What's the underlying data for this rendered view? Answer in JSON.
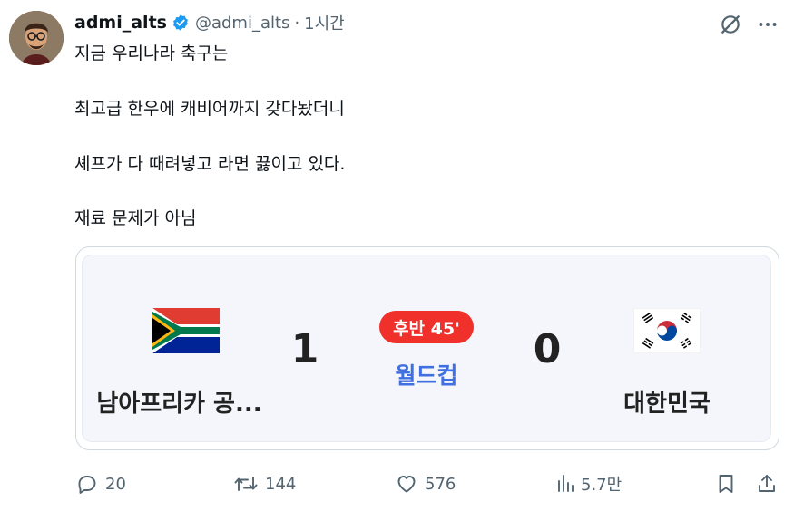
{
  "tweet": {
    "display_name": "admi_alts",
    "handle": "@admi_alts",
    "separator": "·",
    "time": "1시간",
    "lines": [
      "지금 우리나라 축구는",
      "최고급 한우에 캐비어까지 갖다놨더니",
      "셰프가 다 때려넣고 라면 끓이고 있다.",
      "재료 문제가 아님"
    ]
  },
  "scorecard": {
    "home_team": "남아프리카 공...",
    "home_score": "1",
    "away_team": "대한민국",
    "away_score": "0",
    "status": "후반 45'",
    "competition": "월드컵",
    "status_color": "#f0302b",
    "competition_color": "#3f6fe0"
  },
  "actions": {
    "replies": "20",
    "reposts": "144",
    "likes": "576",
    "views": "5.7만"
  },
  "icons": {
    "verified": "verified-badge-icon",
    "grok": "grok-icon",
    "more": "more-icon",
    "reply": "reply-icon",
    "repost": "repost-icon",
    "like": "heart-icon",
    "views": "views-icon",
    "bookmark": "bookmark-icon",
    "share": "share-icon"
  },
  "colors": {
    "verified_blue": "#1d9bf0",
    "text_primary": "#0f1419",
    "text_secondary": "#536471"
  }
}
